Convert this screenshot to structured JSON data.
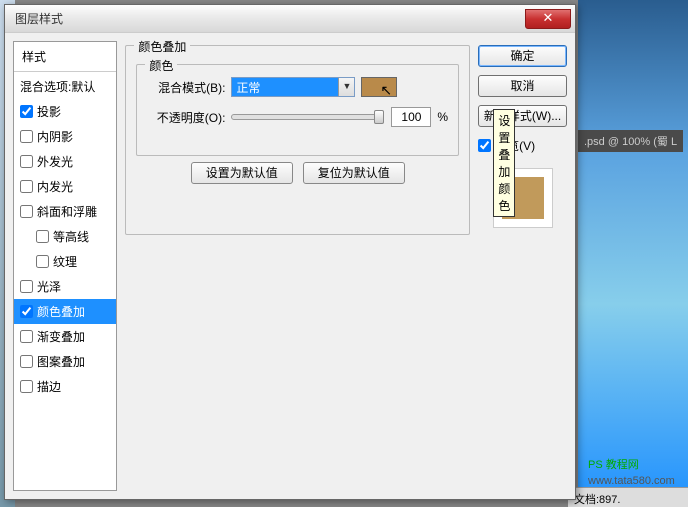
{
  "window": {
    "title": "图层样式",
    "close": "✕"
  },
  "sidebar": {
    "header": "样式",
    "items": [
      {
        "label": "混合选项:默认",
        "checked": false,
        "checkbox": false
      },
      {
        "label": "投影",
        "checked": true,
        "checkbox": true
      },
      {
        "label": "内阴影",
        "checked": false,
        "checkbox": true
      },
      {
        "label": "外发光",
        "checked": false,
        "checkbox": true
      },
      {
        "label": "内发光",
        "checked": false,
        "checkbox": true
      },
      {
        "label": "斜面和浮雕",
        "checked": false,
        "checkbox": true
      },
      {
        "label": "等高线",
        "checked": false,
        "checkbox": true,
        "sub": true
      },
      {
        "label": "纹理",
        "checked": false,
        "checkbox": true,
        "sub": true
      },
      {
        "label": "光泽",
        "checked": false,
        "checkbox": true
      },
      {
        "label": "颜色叠加",
        "checked": true,
        "checkbox": true,
        "selected": true
      },
      {
        "label": "渐变叠加",
        "checked": false,
        "checkbox": true
      },
      {
        "label": "图案叠加",
        "checked": false,
        "checkbox": true
      },
      {
        "label": "描边",
        "checked": false,
        "checkbox": true
      }
    ]
  },
  "panel": {
    "group_title": "颜色叠加",
    "inner_title": "颜色",
    "blend_label": "混合模式(B):",
    "blend_value": "正常",
    "opacity_label": "不透明度(O):",
    "opacity_value": "100",
    "opacity_unit": "%",
    "swatch_color": "#b98a4a",
    "tooltip": "设置叠加颜色",
    "default_btn": "设置为默认值",
    "reset_btn": "复位为默认值"
  },
  "actions": {
    "ok": "确定",
    "cancel": "取消",
    "new_style": "新建样式(W)...",
    "preview": "预览(V)"
  },
  "background": {
    "psd_tab": ".psd @ 100% (蜀 L",
    "ps_site": "PS 教程网",
    "url": "www.tata580.com",
    "status": "文档:897."
  }
}
